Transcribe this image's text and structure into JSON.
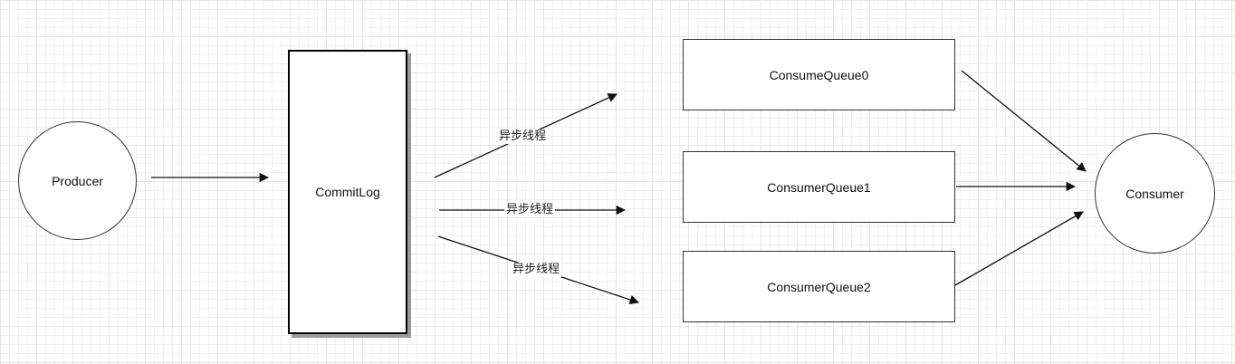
{
  "nodes": {
    "producer": "Producer",
    "commitlog": "CommitLog",
    "queue0": "ConsumeQueue0",
    "queue1": "ConsumerQueue1",
    "queue2": "ConsumerQueue2",
    "consumer": "Consumer"
  },
  "edge_labels": {
    "async_top": "异步线程",
    "async_mid": "异步线程",
    "async_bottom": "异步线程"
  }
}
